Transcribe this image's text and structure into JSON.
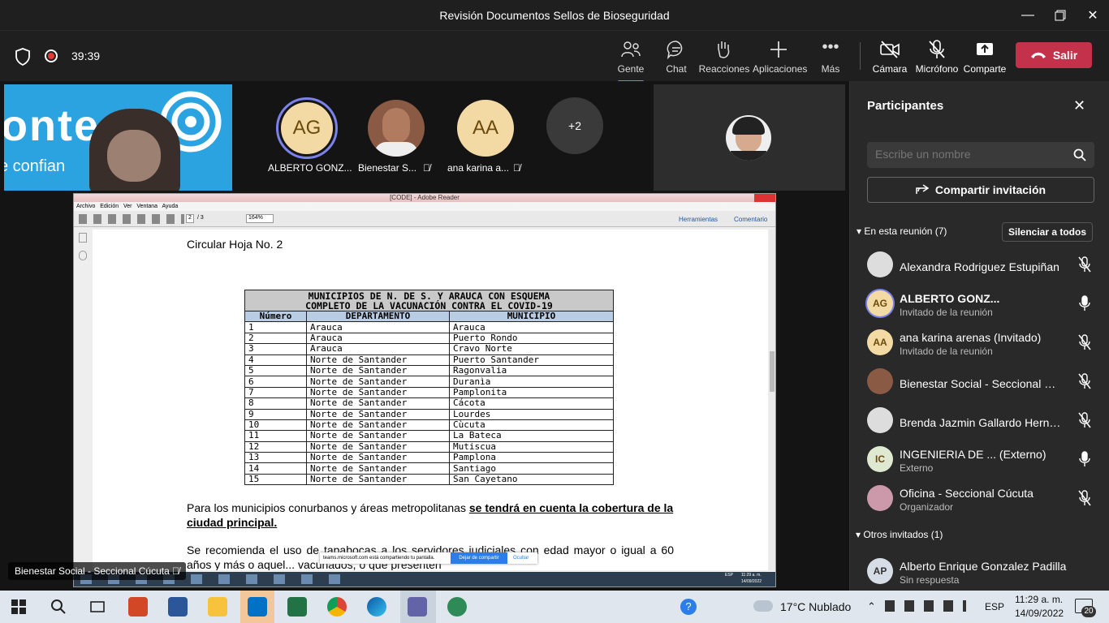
{
  "window": {
    "title": "Revisión Documentos Sellos de Bioseguridad"
  },
  "meeting": {
    "time": "39:39"
  },
  "toolbar": {
    "people": "Gente",
    "chat": "Chat",
    "reactions": "Reacciones",
    "apps": "Aplicaciones",
    "more": "Más",
    "camera": "Cámara",
    "mic": "Micrófono",
    "share": "Comparte",
    "leave": "Salir"
  },
  "tiles": [
    {
      "initials": "AG",
      "name": "ALBERTO GONZ...",
      "color": "#f3d9a4"
    },
    {
      "initials": "",
      "name": "Bienestar S...",
      "color": "#8a5a44"
    },
    {
      "initials": "AA",
      "name": "ana karina a...",
      "color": "#f3d9a4"
    },
    {
      "initials": "+2",
      "name": "",
      "color": "#3a3a3a"
    }
  ],
  "video_label": "Bienestar Social - Seccional Cúcuta",
  "video_logo": "ontec",
  "video_sub": "e confian",
  "panel": {
    "title": "Participantes",
    "search_placeholder": "Escribe un nombre",
    "invite": "Compartir invitación",
    "in_meeting": "En esta reunión (7)",
    "mute_all": "Silenciar a todos",
    "others": "Otros invitados (1)",
    "participants": [
      {
        "initials": "",
        "name": "Alexandra Rodriguez Estupiñan",
        "sub": "",
        "color": "#ddd"
      },
      {
        "initials": "AG",
        "name": "ALBERTO GONZ...",
        "sub": "Invitado de la reunión",
        "color": "#f3d9a4"
      },
      {
        "initials": "AA",
        "name": "ana karina arenas (Invitado)",
        "sub": "Invitado de la reunión",
        "color": "#f3d9a4"
      },
      {
        "initials": "",
        "name": "Bienestar Social - Seccional Cúc...",
        "sub": "",
        "color": "#8a5a44"
      },
      {
        "initials": "",
        "name": "Brenda Jazmin Gallardo Hernan...",
        "sub": "",
        "color": "#ddd"
      },
      {
        "initials": "IC",
        "name": "INGENIERIA DE ...  (Externo)",
        "sub": "Externo",
        "color": "#dfe8d0"
      },
      {
        "initials": "",
        "name": "Oficina - Seccional Cúcuta",
        "sub": "Organizador",
        "color": "#c9a"
      }
    ],
    "invited": {
      "initials": "AP",
      "name": "Alberto Enrique Gonzalez Padilla",
      "sub": "Sin respuesta"
    }
  },
  "pdf": {
    "title": "[CODE] - Adobe Reader",
    "menu": [
      "Archivo",
      "Edición",
      "Ver",
      "Ventana",
      "Ayuda"
    ],
    "page": "2",
    "pages": "/ 3",
    "zoom": "164%",
    "tools": "Herramientas",
    "comment": "Comentario",
    "heading": "Circular Hoja No. 2",
    "table_title1": "MUNICIPIOS DE N. DE S. Y ARAUCA CON ESQUEMA",
    "table_title2": "COMPLETO DE LA VACUNACIÓN  CONTRA EL COVID-19",
    "headers": [
      "Número",
      "DEPARTAMENTO",
      "MUNICIPIO"
    ],
    "rows": [
      [
        "1",
        "Arauca",
        "Arauca"
      ],
      [
        "2",
        "Arauca",
        "Puerto Rondo"
      ],
      [
        "3",
        "Arauca",
        "Cravo Norte"
      ],
      [
        "4",
        "Norte de Santander",
        "Puerto Santander"
      ],
      [
        "5",
        "Norte de Santander",
        "Ragonvalia"
      ],
      [
        "6",
        "Norte de Santander",
        "Duranìa"
      ],
      [
        "7",
        "Norte de Santander",
        "Pamplonita"
      ],
      [
        "8",
        "Norte de Santander",
        "Cácota"
      ],
      [
        "9",
        "Norte de Santander",
        "Lourdes"
      ],
      [
        "10",
        "Norte de Santander",
        "Cùcuta"
      ],
      [
        "11",
        "Norte de Santander",
        "La Bateca"
      ],
      [
        "12",
        "Norte de Santander",
        "Mutiscua"
      ],
      [
        "13",
        "Norte de Santander",
        "Pamplona"
      ],
      [
        "14",
        "Norte de Santander",
        "Santiago"
      ],
      [
        "15",
        "Norte de Santander",
        "San Cayetano"
      ]
    ],
    "para1a": "Para los municipios conurbanos y áreas metropolitanas ",
    "para1b": "se tendrá en cuenta la cobertura de la ciudad principal.",
    "para2": "Se recomienda el uso de tapabocas a los servidores judiciales con edad mayor o igual a 60 años y más o aquel... vacunados, o que presenten",
    "share_msg": "teams.microsoft.com está compartiendo tu pantalla.",
    "stop_share": "Dejar de compartir",
    "hide": "Ocultar",
    "inner_time": "11:29 a. m.",
    "inner_date": "14/09/2022",
    "inner_lang": "ESP"
  },
  "taskbar": {
    "weather": "17°C  Nublado",
    "lang": "ESP",
    "time": "11:29 a. m.",
    "date": "14/09/2022",
    "notif": "20"
  }
}
